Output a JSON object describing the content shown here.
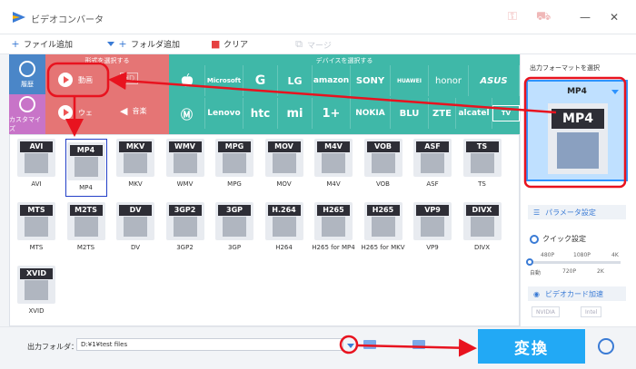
{
  "window": {
    "title": "ビデオコンバータ",
    "key_icon": "key-icon",
    "cart_icon": "cart-icon",
    "minimize_glyph": "—",
    "close_glyph": "✕"
  },
  "toolbar": {
    "add_file": "ファイル追加",
    "add_folder": "フォルダ追加",
    "clear": "クリア",
    "merge": "マージ"
  },
  "leftnav": {
    "history": "履歴",
    "customize": "カスタマイズ"
  },
  "categories": {
    "header": "形式を選択する",
    "video": "動画",
    "audio": "音楽",
    "web": "ウェ"
  },
  "devices": {
    "header": "デバイスを選択する",
    "row1": [
      "",
      "Microsoft",
      "G",
      "LG",
      "amazon",
      "SONY",
      "HUAWEI",
      "honor",
      "ASUS"
    ],
    "row2": [
      "",
      "Lenovo",
      "htc",
      "mi",
      "1+",
      "NOKIA",
      "BLU",
      "ZTE",
      "alcatel",
      "TV"
    ]
  },
  "formats": [
    {
      "tag": "AVI",
      "label": "AVI"
    },
    {
      "tag": "MP4",
      "label": "MP4"
    },
    {
      "tag": "MKV",
      "label": "MKV"
    },
    {
      "tag": "WMV",
      "label": "WMV"
    },
    {
      "tag": "MPG",
      "label": "MPG"
    },
    {
      "tag": "MOV",
      "label": "MOV"
    },
    {
      "tag": "M4V",
      "label": "M4V"
    },
    {
      "tag": "VOB",
      "label": "VOB"
    },
    {
      "tag": "ASF",
      "label": "ASF"
    },
    {
      "tag": "TS",
      "label": "TS"
    },
    {
      "tag": "MTS",
      "label": "MTS"
    },
    {
      "tag": "M2TS",
      "label": "M2TS"
    },
    {
      "tag": "DV",
      "label": "DV"
    },
    {
      "tag": "3GP2",
      "label": "3GP2"
    },
    {
      "tag": "3GP",
      "label": "3GP"
    },
    {
      "tag": "H.264",
      "label": "H264"
    },
    {
      "tag": "H265",
      "label": "H265 for MP4"
    },
    {
      "tag": "H265",
      "label": "H265 for MKV"
    },
    {
      "tag": "VP9",
      "label": "VP9"
    },
    {
      "tag": "DIVX",
      "label": "DIVX"
    },
    {
      "tag": "XVID",
      "label": "XVID"
    }
  ],
  "output": {
    "title": "出力フォーマットを選択",
    "format": "MP4",
    "param_button": "パラメータ設定",
    "quick_label": "クイック設定",
    "scale_top": [
      "480P",
      "1080P",
      "4K"
    ],
    "scale_bottom": [
      "自動",
      "720P",
      "2K"
    ],
    "slider_value": 0,
    "gpu_button": "ビデオカード加速",
    "gpu_chips": [
      "NVIDIA",
      "Intel"
    ]
  },
  "bottom": {
    "folder_label": "出力フォルダ：",
    "path": "D:¥1¥test files",
    "convert": "変換"
  },
  "colors": {
    "accent": "#22a9f5",
    "video_band": "#e57575",
    "device_band": "#3fb8a8",
    "annotation": "#e8131f"
  }
}
